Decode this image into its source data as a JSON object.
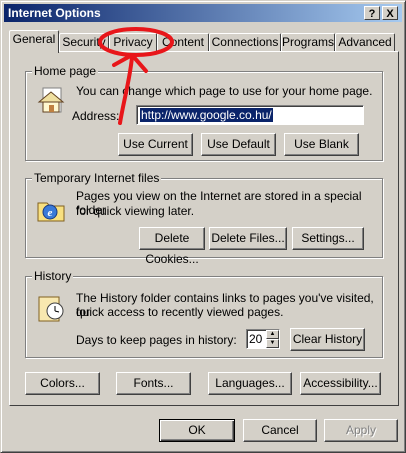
{
  "window": {
    "title": "Internet Options",
    "help_button": "?",
    "close_button": "X"
  },
  "tabs": [
    "General",
    "Security",
    "Privacy",
    "Content",
    "Connections",
    "Programs",
    "Advanced"
  ],
  "home_page": {
    "legend": "Home page",
    "description": "You can change which page to use for your home page.",
    "address_label": "Address:",
    "address_value": "http://www.google.co.hu/",
    "use_current": "Use Current",
    "use_default": "Use Default",
    "use_blank": "Use Blank"
  },
  "temp_files": {
    "legend": "Temporary Internet files",
    "description_line1": "Pages you view on the Internet are stored in a special folder",
    "description_line2": "for quick viewing later.",
    "delete_cookies": "Delete Cookies...",
    "delete_files": "Delete Files...",
    "settings": "Settings..."
  },
  "history": {
    "legend": "History",
    "description_line1": "The History folder contains links to pages you've visited, for",
    "description_line2": "quick access to recently viewed pages.",
    "days_label": "Days to keep pages in history:",
    "days_value": "20",
    "clear_history": "Clear History"
  },
  "bottom_buttons": {
    "colors": "Colors...",
    "fonts": "Fonts...",
    "languages": "Languages...",
    "accessibility": "Accessibility..."
  },
  "dialog_buttons": {
    "ok": "OK",
    "cancel": "Cancel",
    "apply": "Apply"
  },
  "colors": {
    "title_bar_start": "#0a246a",
    "title_bar_end": "#a6caf0",
    "face": "#d4d0c8",
    "annotation_red": "#e8161a"
  }
}
